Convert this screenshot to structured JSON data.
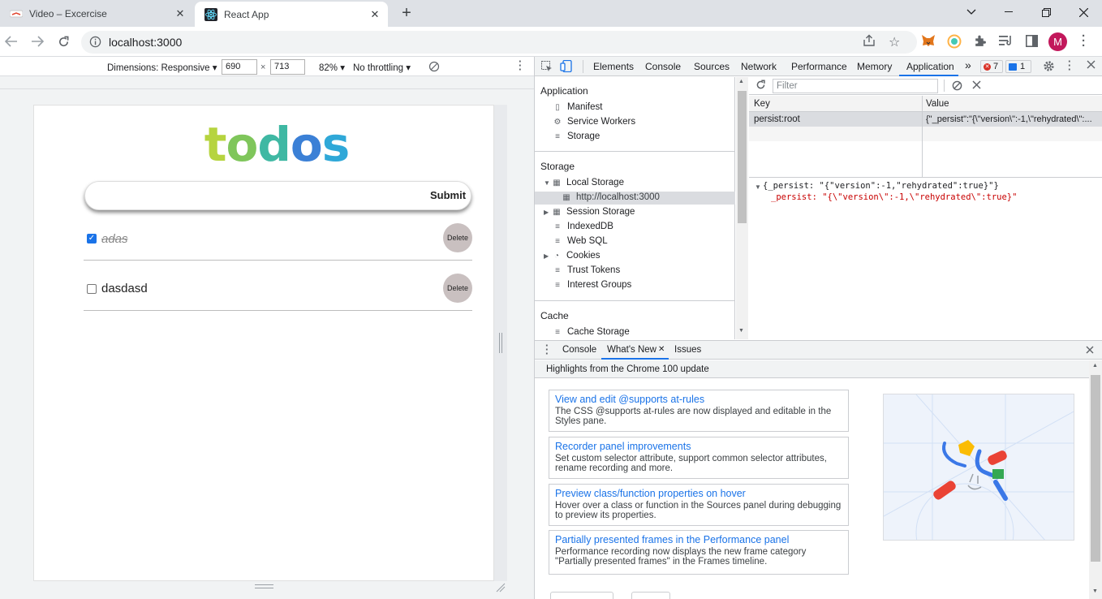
{
  "browser": {
    "tabs": [
      {
        "title": "Video – Excercise",
        "active": false
      },
      {
        "title": "React App",
        "active": true
      }
    ],
    "url": "localhost:3000",
    "profile_initial": "M"
  },
  "device_toolbar": {
    "dimensions_label": "Dimensions: Responsive",
    "width": "690",
    "height": "713",
    "times": "×",
    "zoom": "82%",
    "throttling": "No throttling"
  },
  "app": {
    "logo": {
      "t": "t",
      "o1": "o",
      "d": "d",
      "o2": "o",
      "s": "s"
    },
    "input_value": "",
    "submit_label": "Submit",
    "todos": [
      {
        "text": "adas",
        "done": true,
        "delete_label": "Delete"
      },
      {
        "text": "dasdasd",
        "done": false,
        "delete_label": "Delete"
      }
    ]
  },
  "devtools": {
    "tabs": [
      "Elements",
      "Console",
      "Sources",
      "Network",
      "Performance",
      "Memory",
      "Application"
    ],
    "active_tab": "Application",
    "more": "»",
    "errors": "7",
    "messages": "1",
    "sidebar": {
      "application_header": "Application",
      "application_items": [
        "Manifest",
        "Service Workers",
        "Storage"
      ],
      "storage_header": "Storage",
      "local_storage": "Local Storage",
      "local_storage_origin": "http://localhost:3000",
      "session_storage": "Session Storage",
      "storage_items": [
        "IndexedDB",
        "Web SQL",
        "Cookies",
        "Trust Tokens",
        "Interest Groups"
      ],
      "cache_header": "Cache",
      "cache_items": [
        "Cache Storage"
      ]
    },
    "filter_placeholder": "Filter",
    "table": {
      "key_header": "Key",
      "value_header": "Value",
      "rows": [
        {
          "key": "persist:root",
          "value": "{\"_persist\":\"{\\\"version\\\":-1,\\\"rehydrated\\\":..."
        }
      ]
    },
    "preview_line1": "{_persist: \"{\"version\":-1,\"rehydrated\":true}\"}",
    "preview_line2": "_persist: \"{\\\"version\\\":-1,\\\"rehydrated\\\":true}\"",
    "drawer": {
      "tabs": [
        "Console",
        "What's New",
        "Issues"
      ],
      "active_tab": "What's New",
      "highlights": "Highlights from the Chrome 100 update",
      "cards": [
        {
          "title": "View and edit @supports at-rules",
          "desc": "The CSS @supports at-rules are now displayed and editable in the Styles pane."
        },
        {
          "title": "Recorder panel improvements",
          "desc": "Set custom selector attribute, support common selector attributes, rename recording and more."
        },
        {
          "title": "Preview class/function properties on hover",
          "desc": "Hover over a class or function in the Sources panel during debugging to preview its properties."
        },
        {
          "title": "Partially presented frames in the Performance panel",
          "desc": "Performance recording now displays the new frame category \"Partially presented frames\" in the Frames timeline."
        }
      ]
    }
  },
  "colors": {
    "logo_t": "#b6d43f",
    "logo_o1": "#7fc65b",
    "logo_d": "#3fb8a3",
    "logo_o2": "#3b80d6",
    "logo_s": "#2fa8d8",
    "link": "#1a73e8",
    "accent": "#1a73e8"
  }
}
